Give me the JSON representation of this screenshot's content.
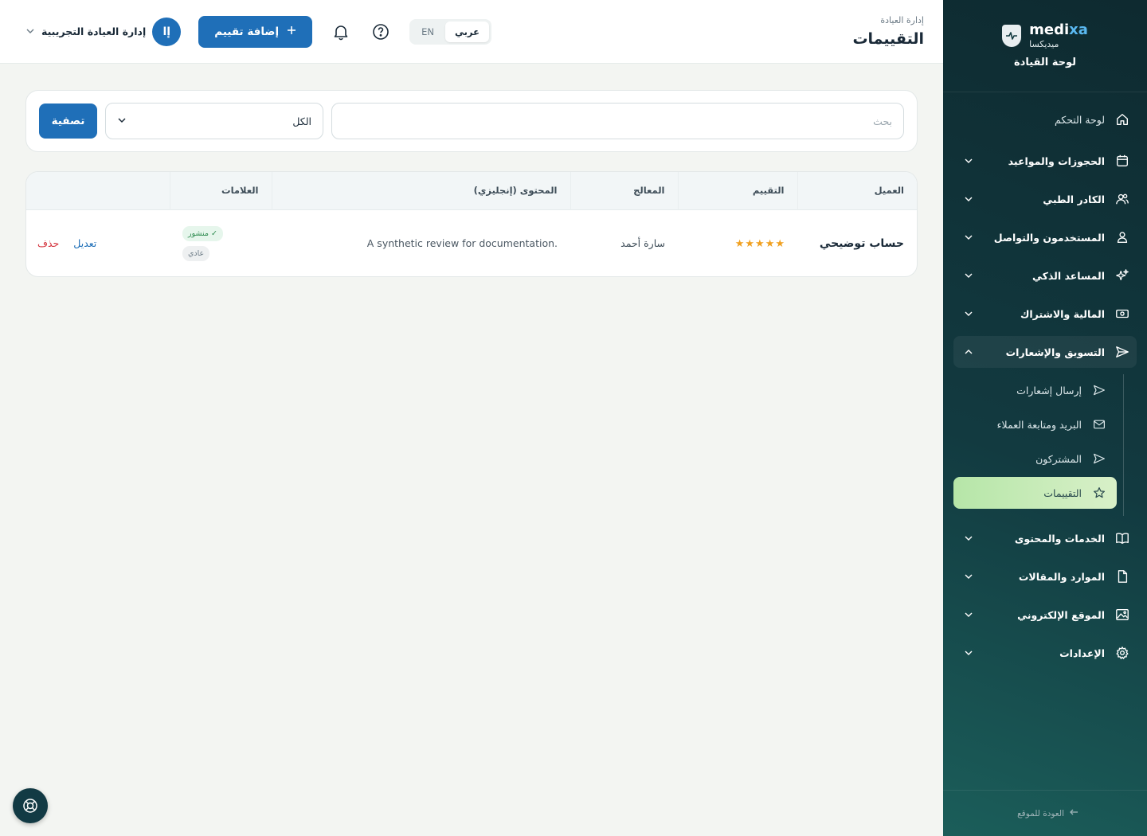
{
  "sidebar": {
    "brand_en_prefix": "medi",
    "brand_en_suffix": "xa",
    "brand_ar": "ميديكسا",
    "subtitle": "لوحة القيادة",
    "dashboard_label": "لوحة التحكم",
    "groups": [
      {
        "label": "الحجوزات والمواعيد"
      },
      {
        "label": "الكادر الطبي"
      },
      {
        "label": "المستخدمون والتواصل"
      },
      {
        "label": "المساعد الذكي"
      },
      {
        "label": "المالية والاشتراك"
      },
      {
        "label": "التسويق والإشعارات"
      },
      {
        "label": "الخدمات والمحتوى"
      },
      {
        "label": "الموارد والمقالات"
      },
      {
        "label": "الموقع الإلكتروني"
      },
      {
        "label": "الإعدادات"
      }
    ],
    "marketing_sub": [
      {
        "label": "إرسال إشعارات"
      },
      {
        "label": "البريد ومتابعة العملاء"
      },
      {
        "label": "المشتركون"
      },
      {
        "label": "التقييمات"
      }
    ],
    "back_label": "العودة للموقع"
  },
  "header": {
    "breadcrumb": "إدارة العيادة",
    "title": "التقييمات",
    "lang_ar": "عربي",
    "lang_en": "EN",
    "add_label": "إضافة تقييم",
    "user_initial": "إا",
    "user_name": "إدارة العيادة التجريبية"
  },
  "filters": {
    "search_placeholder": "بحث",
    "select_value": "الكل",
    "filter_label": "تصفية"
  },
  "table": {
    "columns": [
      "العميل",
      "التقييم",
      "المعالج",
      "المحتوى (إنجليزي)",
      "العلامات",
      ""
    ],
    "rows": [
      {
        "client": "حساب توضيحي",
        "rating": 5,
        "therapist": "سارة أحمد",
        "content": "A synthetic review for documentation.",
        "tag_published": "✓ منشور",
        "tag_normal": "عادي",
        "edit_label": "تعديل",
        "delete_label": "حذف"
      }
    ]
  },
  "colors": {
    "primary": "#1f6fb8",
    "sidebar_bg": "#123a40",
    "active_item": "#c9ecb8",
    "danger": "#d3303a",
    "star": "#f0a020"
  },
  "icons": {
    "support": "lifebuoy-icon",
    "notifications": "bell-icon",
    "help": "help-circle-icon"
  }
}
